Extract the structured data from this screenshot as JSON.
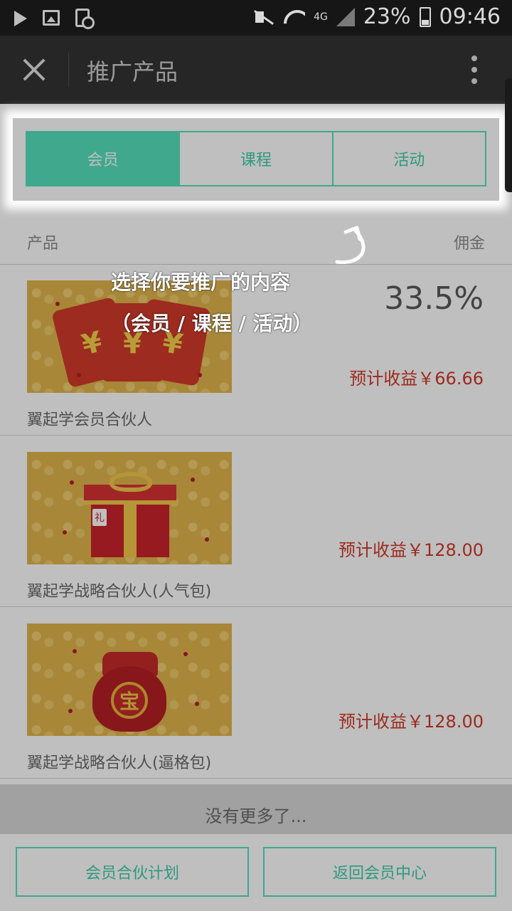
{
  "status_bar": {
    "network": "4G",
    "battery": "23%",
    "time": "09:46"
  },
  "app_bar": {
    "title": "推广产品"
  },
  "tabs": [
    "会员",
    "课程",
    "活动"
  ],
  "list_header": {
    "left": "产品",
    "right": "佣金"
  },
  "items": [
    {
      "name": "翼起学会员合伙人",
      "percent": "33.5%",
      "estimate": "预计收益￥66.66"
    },
    {
      "name": "翼起学战略合伙人(人气包)",
      "estimate": "预计收益￥128.00"
    },
    {
      "name": "翼起学战略合伙人(逼格包)",
      "estimate": "预计收益￥128.00"
    }
  ],
  "no_more": "没有更多了...",
  "footer": {
    "left": "会员合伙计划",
    "right": "返回会员中心"
  },
  "overlay_tip": {
    "line1": "选择你要推广的内容",
    "line2": "（会员 / 课程 / 活动）"
  },
  "thumb_art": {
    "yuan": "¥",
    "seal": "礼",
    "bao": "宝"
  }
}
